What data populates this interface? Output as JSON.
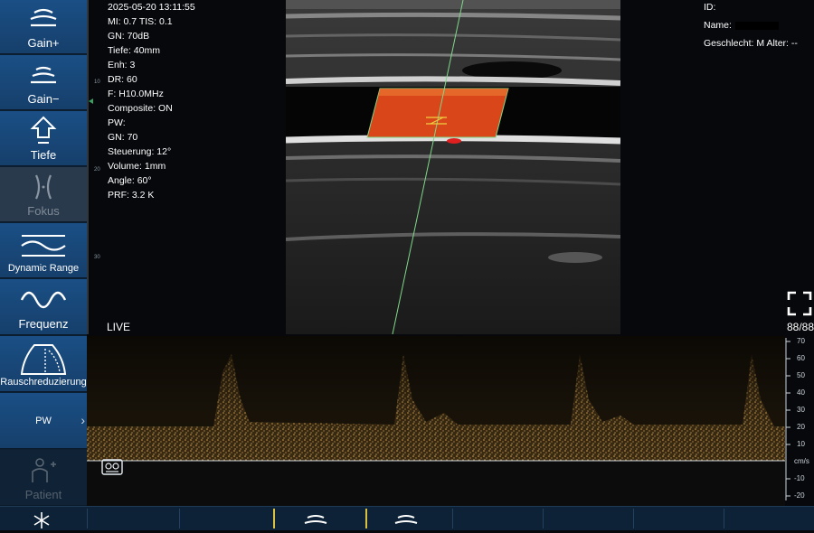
{
  "sidebar": {
    "items": [
      {
        "label": "Gain+",
        "icon": "gain-plus-icon",
        "state": "active"
      },
      {
        "label": "Gain−",
        "icon": "gain-minus-icon",
        "state": "active"
      },
      {
        "label": "Tiefe",
        "icon": "depth-icon",
        "state": "active"
      },
      {
        "label": "Fokus",
        "icon": "focus-icon",
        "state": "dim"
      },
      {
        "label": "Dynamic Range",
        "icon": "dynamic-range-icon",
        "state": "active"
      },
      {
        "label": "Frequenz",
        "icon": "frequency-icon",
        "state": "active"
      },
      {
        "label": "Rauschreduzierung",
        "icon": "noise-reduction-icon",
        "state": "active"
      },
      {
        "label": "PW",
        "icon": "chevron-right-icon",
        "state": "active"
      },
      {
        "label": "Patient",
        "icon": "patient-icon",
        "state": "disabled"
      }
    ]
  },
  "ruler": {
    "ticks": [
      "10",
      "20",
      "30"
    ]
  },
  "info_left": [
    "2025-05-20 13:11:55",
    "MI: 0.7   TIS: 0.1",
    "GN: 70dB",
    "Tiefe: 40mm",
    "Enh: 3",
    "DR: 60",
    "F: H10.0MHz",
    "Composite: ON",
    "PW:",
    "GN: 70",
    "Steuerung: 12°",
    "Volume: 1mm",
    "Angle: 60°",
    "PRF: 3.2 K"
  ],
  "info_right": {
    "id_label": "ID:",
    "name_label": "Name:",
    "sex_age": "Geschlecht: M  Alter: --"
  },
  "status": {
    "live": "LIVE",
    "frame": "88/88"
  },
  "velocity_scale": {
    "ticks": [
      "70",
      "60",
      "50",
      "40",
      "30",
      "20",
      "10",
      "-10",
      "-20"
    ],
    "unit": "cm/s"
  },
  "colors": {
    "sidebar": "#163f6b",
    "accent": "#d8c040",
    "doppler": "#c89a4a",
    "colorbox": "#e0501e"
  }
}
